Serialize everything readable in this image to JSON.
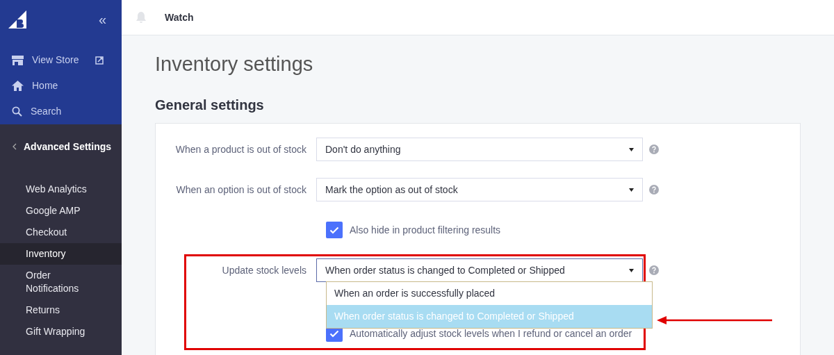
{
  "sidebar": {
    "collapse": "«",
    "top_items": [
      {
        "kind": "store",
        "label": "View Store",
        "external": true
      },
      {
        "kind": "home",
        "label": "Home",
        "external": false
      },
      {
        "kind": "search",
        "label": "Search",
        "external": false
      }
    ],
    "section": "Advanced Settings",
    "items": [
      {
        "label": "Web Analytics",
        "selected": false
      },
      {
        "label": "Google AMP",
        "selected": false
      },
      {
        "label": "Checkout",
        "selected": false
      },
      {
        "label": "Inventory",
        "selected": true
      },
      {
        "label": "Order Notifications",
        "selected": false
      },
      {
        "label": "Returns",
        "selected": false
      },
      {
        "label": "Gift Wrapping",
        "selected": false
      }
    ]
  },
  "header": {
    "title": "Watch"
  },
  "page_title": "Inventory settings",
  "section_title": "General settings",
  "settings": [
    {
      "kind": "select",
      "label": "When a product is out of stock",
      "value": "Don't do anything",
      "open": false
    },
    {
      "kind": "select",
      "label": "When an option is out of stock",
      "value": "Mark the option as out of stock",
      "open": false
    },
    {
      "kind": "checkbox",
      "label": "Also hide in product filtering results",
      "checked": true
    },
    {
      "kind": "select",
      "label": "Update stock levels",
      "value": "When order status is changed to Completed or Shipped",
      "open": true,
      "options": [
        {
          "label": "When an order is successfully placed",
          "selected": false
        },
        {
          "label": "When order status is changed to Completed or Shipped",
          "selected": true
        }
      ]
    },
    {
      "kind": "checkbox",
      "label": "Automatically adjust stock levels when I refund or cancel an order",
      "checked": true
    }
  ]
}
